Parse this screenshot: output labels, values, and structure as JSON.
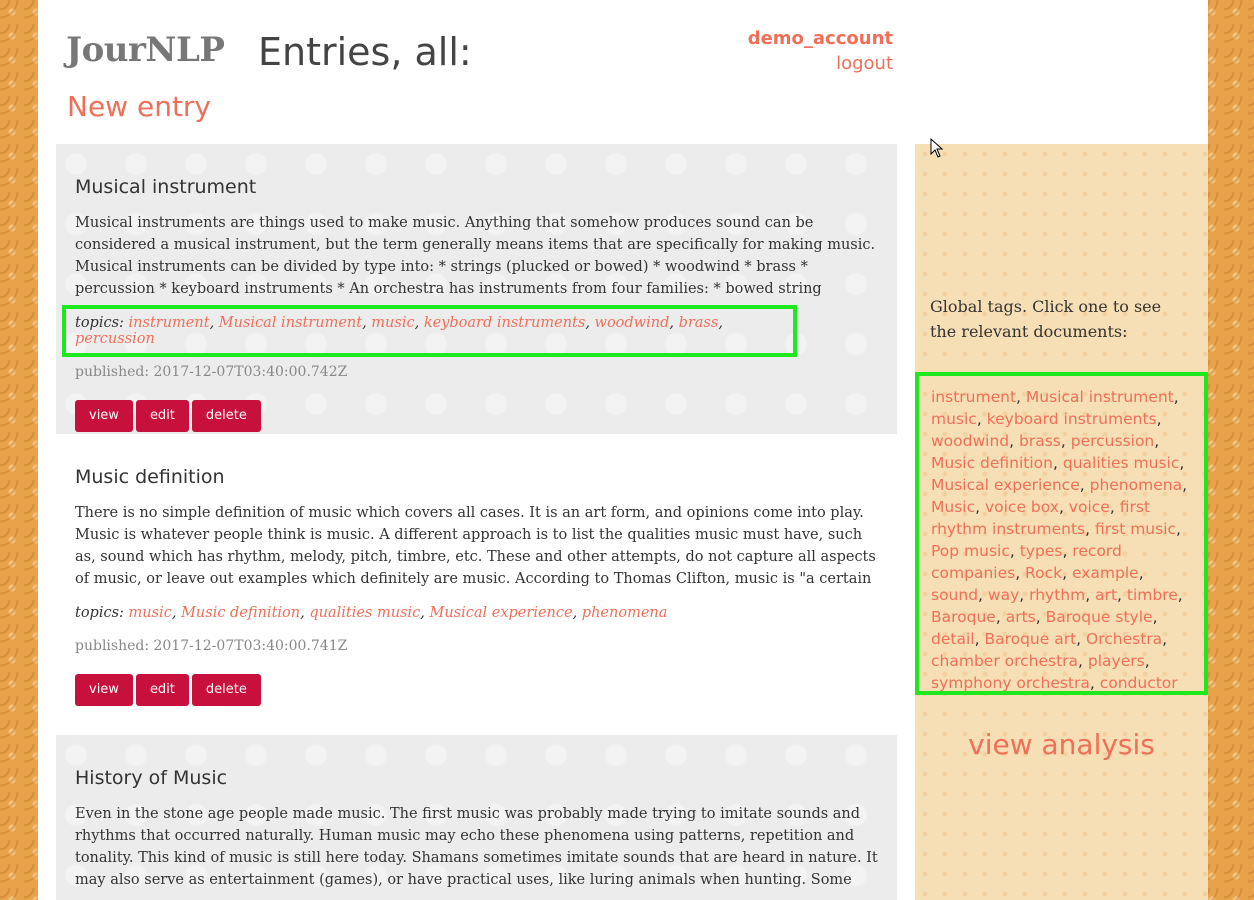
{
  "header": {
    "logo": "JourNLP",
    "title": "Entries, all:",
    "new_entry": "New entry",
    "username": "demo_account",
    "logout": "logout"
  },
  "entries": [
    {
      "title": "Musical instrument",
      "body": "Musical instruments are things used to make music. Anything that somehow produces sound can be considered a musical instrument, but the term generally means items that are specifically for making music. Musical instruments can be divided by type into: * strings (plucked or bowed) * woodwind * brass * percussion * keyboard instruments * An orchestra has instruments from four families: * bowed string instruments (e.g. violin) * woodwin...",
      "topics_label": "topics:",
      "topics": [
        "instrument",
        "Musical instrument",
        "music",
        "keyboard instruments",
        "woodwind",
        "brass",
        "percussion"
      ],
      "published": "published: 2017-12-07T03:40:00.742Z",
      "buttons": [
        "view",
        "edit",
        "delete"
      ]
    },
    {
      "title": "Music definition",
      "body": "There is no simple definition of music which covers all cases. It is an art form, and opinions come into play. Music is whatever people think is music. A different approach is to list the qualities music must have, such as, sound which has rhythm, melody, pitch, timbre, etc. These and other attempts, do not capture all aspects of music, or leave out examples which definitely are music. According to Thomas Clifton, music is \"a certain reciprocal relation...",
      "topics_label": "topics:",
      "topics": [
        "music",
        "Music definition",
        "qualities music",
        "Musical experience",
        "phenomena"
      ],
      "published": "published: 2017-12-07T03:40:00.741Z",
      "buttons": [
        "view",
        "edit",
        "delete"
      ]
    },
    {
      "title": "History of Music",
      "body": "Even in the stone age people made music. The first music was probably made trying to imitate sounds and rhythms that occurred naturally. Human music may echo these phenomena using patterns, repetition and tonality. This kind of music is still here today. Shamans sometimes imitate sounds that are heard in nature. It may also serve as entertainment (games), or have practical uses, like luring animals when hunting. Some animals also can use musi..."
    }
  ],
  "sidebar": {
    "heading": "Global tags. Click one to see the relevant documents:",
    "tags": [
      "instrument",
      "Musical instrument",
      "music",
      "keyboard instruments",
      "woodwind",
      "brass",
      "percussion",
      "Music definition",
      "qualities music",
      "Musical experience",
      "phenomena",
      "Music",
      "voice box",
      "voice",
      "first rhythm instruments",
      "first music",
      "Pop music",
      "types",
      "record companies",
      "Rock",
      "example",
      "sound",
      "way",
      "rhythm",
      "art",
      "timbre",
      "Baroque",
      "arts",
      "Baroque style",
      "detail",
      "Baroque art",
      "Orchestra",
      "chamber orchestra",
      "players",
      "symphony orchestra",
      "conductor"
    ],
    "view_analysis": "view analysis"
  },
  "colors": {
    "accent": "#ef6f58",
    "button": "#c8103c",
    "highlight": "#1fe81f"
  }
}
